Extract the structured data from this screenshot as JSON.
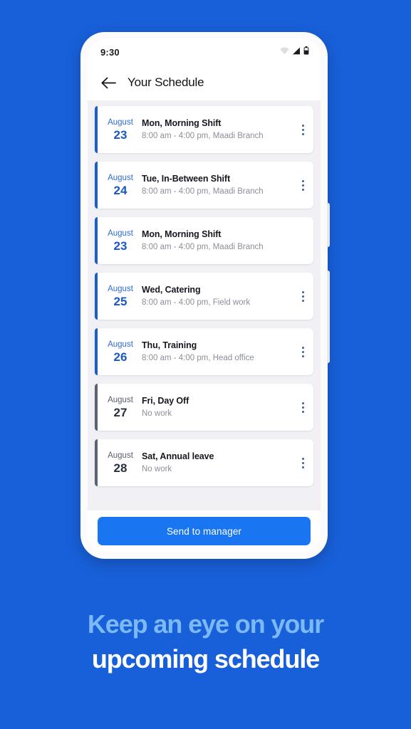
{
  "theme": {
    "page_background": "#1860da",
    "accent_blue": "#1a5fd0",
    "button_blue": "#1976f0",
    "off_gray": "#5b6273",
    "tagline_light": "#7cb9f7",
    "tagline_white": "#ffffff",
    "list_background": "#f1f1f5"
  },
  "status_bar": {
    "time": "9:30",
    "icons": [
      "wifi-icon",
      "cellular-signal-icon",
      "battery-icon"
    ]
  },
  "app_bar": {
    "back_icon": "back-arrow-icon",
    "title": "Your Schedule"
  },
  "schedule": {
    "menu_icon": "overflow-menu-icon",
    "cards": [
      {
        "month": "August",
        "day": "23",
        "title": "Mon, Morning Shift",
        "subtitle": "8:00 am - 4:00 pm, Maadi Branch",
        "type": "work",
        "menu_visible": true
      },
      {
        "month": "August",
        "day": "24",
        "title": "Tue, In-Between Shift",
        "subtitle": "8:00 am - 4:00 pm, Maadi Branch",
        "type": "work",
        "menu_visible": true
      },
      {
        "month": "August",
        "day": "23",
        "title": "Mon, Morning Shift",
        "subtitle": "8:00 am - 4:00 pm, Maadi Branch",
        "type": "work",
        "menu_visible": false
      },
      {
        "month": "August",
        "day": "25",
        "title": "Wed, Catering",
        "subtitle": "8:00 am - 4:00 pm, Field work",
        "type": "work",
        "menu_visible": true
      },
      {
        "month": "August",
        "day": "26",
        "title": "Thu, Training",
        "subtitle": "8:00 am - 4:00 pm, Head office",
        "type": "work",
        "menu_visible": true
      },
      {
        "month": "August",
        "day": "27",
        "title": "Fri, Day Off",
        "subtitle": "No work",
        "type": "off",
        "menu_visible": true
      },
      {
        "month": "August",
        "day": "28",
        "title": "Sat, Annual leave",
        "subtitle": "No work",
        "type": "off",
        "menu_visible": true
      }
    ]
  },
  "bottom_action": {
    "label": "Send to manager"
  },
  "tagline": {
    "line1": "Keep an eye on your",
    "line2": "upcoming schedule"
  }
}
